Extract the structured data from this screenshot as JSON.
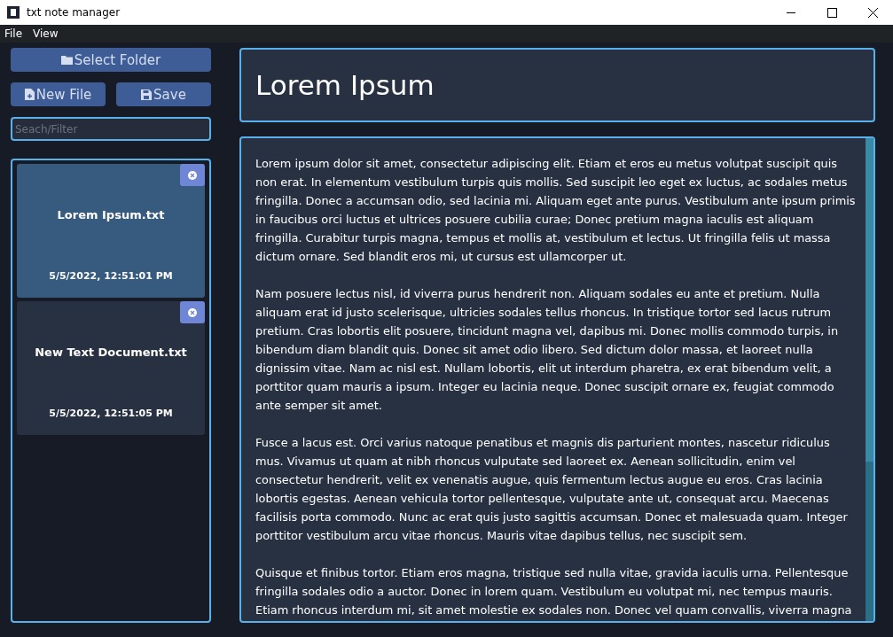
{
  "window": {
    "title": "txt note manager"
  },
  "menu": [
    "File",
    "View"
  ],
  "buttons": {
    "select_folder": "Select Folder",
    "new_file": "New File",
    "save": "Save"
  },
  "search": {
    "placeholder": "Seach/Filter"
  },
  "notes": [
    {
      "name": "Lorem Ipsum.txt",
      "date": "5/5/2022, 12:51:01 PM",
      "selected": true
    },
    {
      "name": "New Text Document.txt",
      "date": "5/5/2022, 12:51:05 PM",
      "selected": false
    }
  ],
  "editor": {
    "title": "Lorem Ipsum",
    "paragraphs": [
      "Lorem ipsum dolor sit amet, consectetur adipiscing elit. Etiam et eros eu metus volutpat suscipit quis non erat. In elementum vestibulum turpis quis mollis. Sed suscipit leo eget ex luctus, ac sodales metus fringilla. Donec a accumsan odio, sed lacinia mi. Aliquam eget ante purus. Vestibulum ante ipsum primis in faucibus orci luctus et ultrices posuere cubilia curae; Donec pretium magna iaculis est aliquam fringilla. Curabitur turpis magna, tempus et mollis at, vestibulum et lectus. Ut fringilla felis ut massa dictum ornare. Sed blandit eros mi, ut cursus est ullamcorper ut.",
      "Nam posuere lectus nisl, id viverra purus hendrerit non. Aliquam sodales eu ante et pretium. Nulla aliquam erat id justo scelerisque, ultricies sodales tellus rhoncus. In tristique tortor sed lacus rutrum pretium. Cras lobortis elit posuere, tincidunt magna vel, dapibus mi. Donec mollis commodo turpis, in bibendum diam blandit quis. Donec sit amet odio libero. Sed dictum dolor massa, et laoreet nulla dignissim vitae. Nam ac nisl est. Nullam lobortis, elit ut interdum pharetra, ex erat bibendum velit, a porttitor quam mauris a ipsum. Integer eu lacinia neque. Donec suscipit ornare ex, feugiat commodo ante semper sit amet.",
      "Fusce a lacus est. Orci varius natoque penatibus et magnis dis parturient montes, nascetur ridiculus mus. Vivamus ut quam at nibh rhoncus vulputate sed laoreet ex. Aenean sollicitudin, enim vel consectetur hendrerit, velit ex venenatis augue, quis fermentum lectus augue eu eros. Cras lacinia lobortis egestas. Aenean vehicula tortor pellentesque, vulputate ante ut, consequat arcu. Maecenas facilisis porta commodo. Nunc ac erat quis justo sagittis accumsan. Donec et malesuada quam. Integer porttitor vestibulum arcu vitae rhoncus. Mauris vitae dapibus tellus, nec suscipit sem.",
      "Quisque et finibus tortor. Etiam eros magna, tristique sed nulla vitae, gravida iaculis urna. Pellentesque fringilla sodales odio a auctor. Donec in lorem quam. Vestibulum eu volutpat mi, nec tempus mauris. Etiam rhoncus interdum mi, sit amet molestie ex sodales non. Donec vel quam convallis, viverra magna"
    ]
  }
}
